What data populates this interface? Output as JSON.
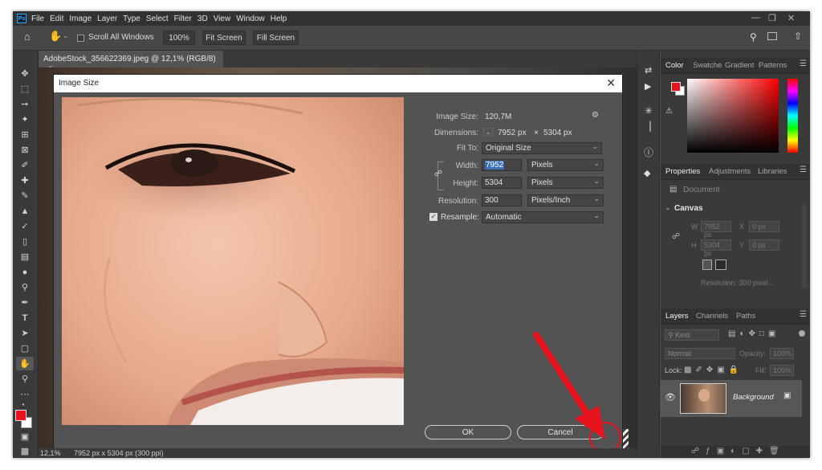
{
  "app": {
    "logo": "Ps"
  },
  "menubar": {
    "items": [
      "File",
      "Edit",
      "Image",
      "Layer",
      "Type",
      "Select",
      "Filter",
      "3D",
      "View",
      "Window",
      "Help"
    ]
  },
  "options": {
    "scroll_all_windows": "Scroll All Windows",
    "zoom": "100%",
    "fit_screen": "Fit Screen",
    "fill_screen": "Fill Screen"
  },
  "document": {
    "tab_title": "AdobeStock_356622369.jpeg @ 12,1% (RGB/8)",
    "status_zoom": "12,1%",
    "status_info": "7952 px x 5304 px (300 ppi)"
  },
  "dialog": {
    "title": "Image Size",
    "image_size_label": "Image Size:",
    "image_size_value": "120,7M",
    "dimensions_label": "Dimensions:",
    "dimensions_w": "7952 px",
    "dimensions_x": "×",
    "dimensions_h": "5304 px",
    "fit_to_label": "Fit To:",
    "fit_to_value": "Original Size",
    "width_label": "Width:",
    "width_value": "7952",
    "width_unit": "Pixels",
    "height_label": "Height:",
    "height_value": "5304",
    "height_unit": "Pixels",
    "resolution_label": "Resolution:",
    "resolution_value": "300",
    "resolution_unit": "Pixels/Inch",
    "resample_label": "Resample:",
    "resample_value": "Automatic",
    "ok": "OK",
    "cancel": "Cancel"
  },
  "color_panel": {
    "tabs": [
      "Color",
      "Swatche",
      "Gradient",
      "Patterns"
    ],
    "fg": "#e8131c",
    "bg": "#ffffff"
  },
  "properties_panel": {
    "tabs": [
      "Properties",
      "Adjustments",
      "Libraries"
    ],
    "doc_label": "Document",
    "section": "Canvas",
    "w_label": "W",
    "w_value": "7952 px",
    "x_label": "X",
    "x_value": "0 px",
    "h_label": "H",
    "h_value": "5304 px",
    "y_label": "Y",
    "y_value": "0 px",
    "resolution": "Resolution: 300 pixel..."
  },
  "layers_panel": {
    "tabs": [
      "Layers",
      "Channels",
      "Paths"
    ],
    "kind": "Kind",
    "blend": "Normal",
    "opacity_label": "Opacity:",
    "opacity_value": "100%",
    "lock_label": "Lock:",
    "fill_label": "Fill:",
    "fill_value": "100%",
    "layer_name": "Background"
  },
  "colors": {
    "annotation": "#e8131c",
    "accent": "#31a8ff"
  }
}
